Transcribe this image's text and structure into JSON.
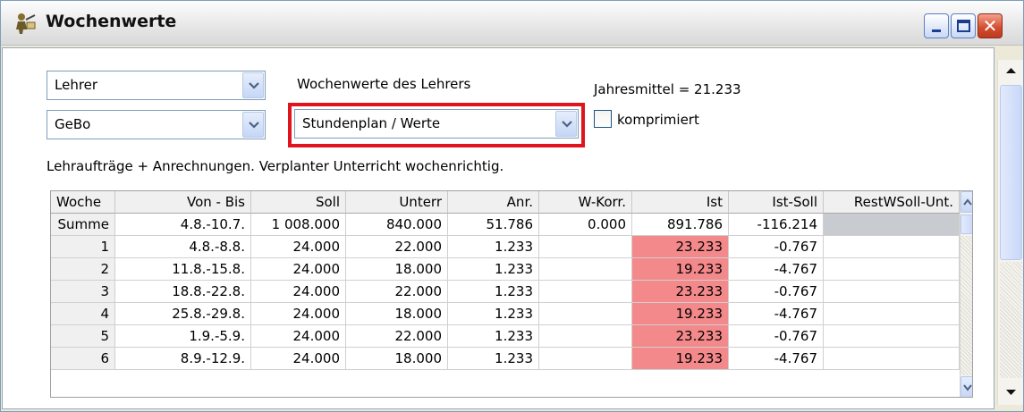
{
  "window": {
    "title": "Wochenwerte",
    "icon": "teacher-figure-icon"
  },
  "controls": {
    "combo_type": "Lehrer",
    "combo_person": "GeBo",
    "view_label": "Wochenwerte des Lehrers",
    "combo_view": "Stundenplan / Werte",
    "jahresmittel": "Jahresmittel = 21.233",
    "komprimiert_label": "komprimiert",
    "komprimiert_checked": false,
    "description": "Lehraufträge + Anrechnungen. Verplanter Unterricht wochenrichtig."
  },
  "table": {
    "columns": [
      "Woche",
      "Von - Bis",
      "Soll",
      "Unterr",
      "Anr.",
      "W-Korr.",
      "Ist",
      "Ist-Soll",
      "RestWSoll-Unt."
    ],
    "rows": [
      [
        "Summe",
        "4.8.-10.7.",
        "1 008.000",
        "840.000",
        "51.786",
        "0.000",
        "891.786",
        "-116.214",
        ""
      ],
      [
        "1",
        "4.8.-8.8.",
        "24.000",
        "22.000",
        "1.233",
        "",
        "23.233",
        "-0.767",
        ""
      ],
      [
        "2",
        "11.8.-15.8.",
        "24.000",
        "18.000",
        "1.233",
        "",
        "19.233",
        "-4.767",
        ""
      ],
      [
        "3",
        "18.8.-22.8.",
        "24.000",
        "22.000",
        "1.233",
        "",
        "23.233",
        "-0.767",
        ""
      ],
      [
        "4",
        "25.8.-29.8.",
        "24.000",
        "18.000",
        "1.233",
        "",
        "19.233",
        "-4.767",
        ""
      ],
      [
        "5",
        "1.9.-5.9.",
        "24.000",
        "22.000",
        "1.233",
        "",
        "23.233",
        "-0.767",
        ""
      ],
      [
        "6",
        "8.9.-12.9.",
        "24.000",
        "18.000",
        "1.233",
        "",
        "19.233",
        "-4.767",
        ""
      ]
    ]
  },
  "colors": {
    "ist_highlight": "#f4898b",
    "summe_rest": "#c8cbd0",
    "focus_box": "#e0141e"
  }
}
